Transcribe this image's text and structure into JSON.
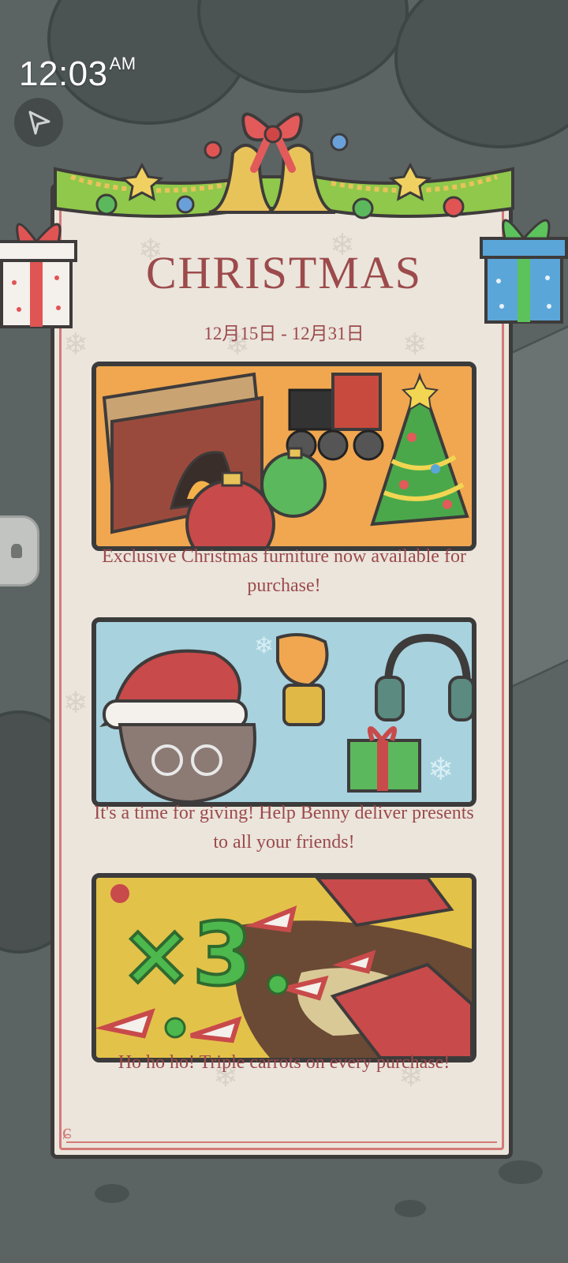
{
  "status_bar": {
    "time": "12:03",
    "ampm": "AM"
  },
  "event": {
    "title": "CHRISTMAS",
    "dates": "12月15日 - 12月31日"
  },
  "banners": [
    {
      "caption": "Exclusive Christmas furniture now available for purchase!"
    },
    {
      "caption": "It's a time for giving! Help Benny deliver presents to all your friends!"
    },
    {
      "caption": "Ho ho ho! Triple carrots on every purchase!"
    }
  ],
  "colors": {
    "accent_text": "#9c4a4b",
    "card_bg": "#ebe5dc",
    "border_dark": "#3e3b3b",
    "border_red": "#d27a78"
  }
}
